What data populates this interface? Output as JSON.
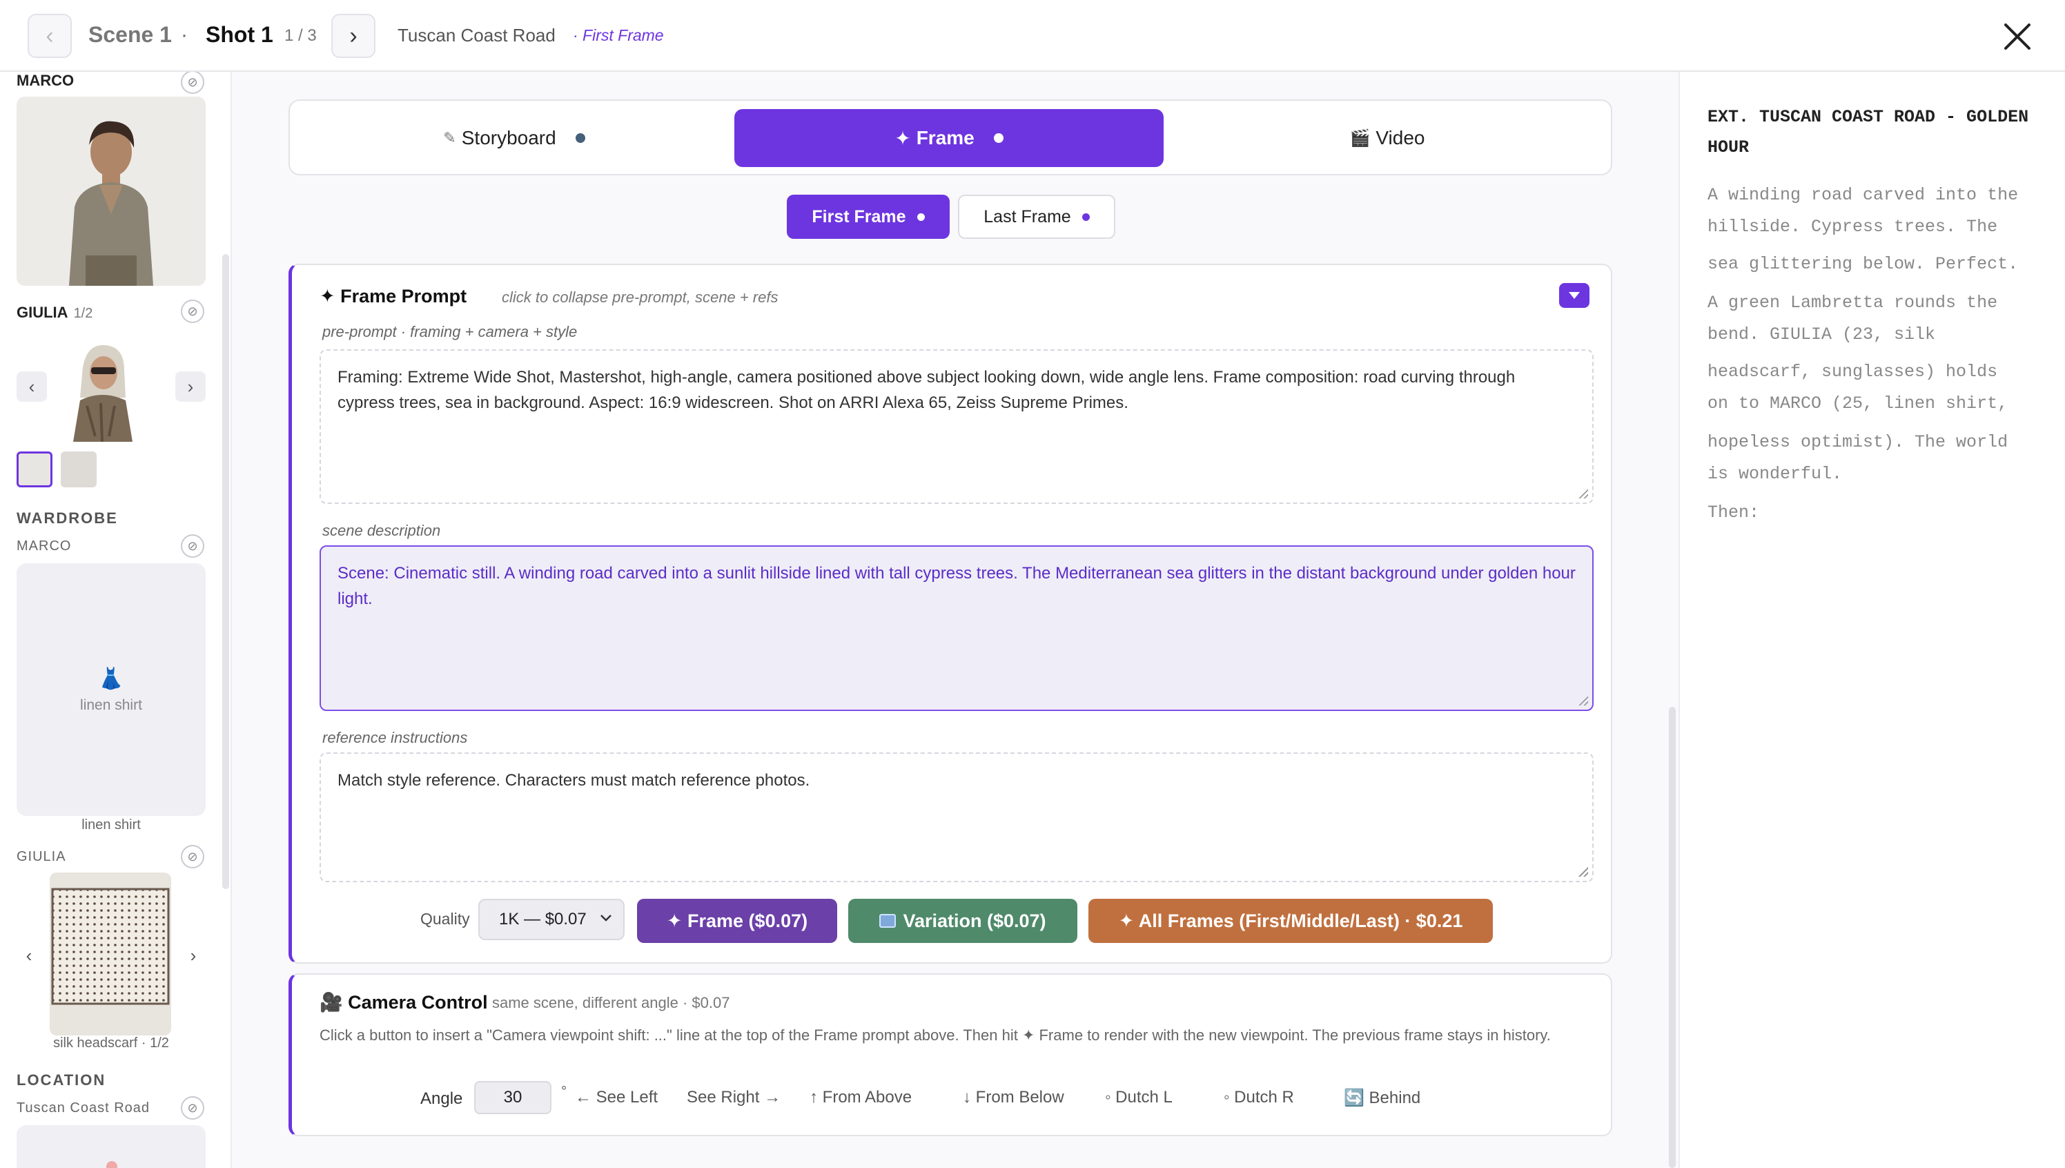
{
  "header": {
    "prev_icon": "chevron-left",
    "scene": "Scene 1",
    "separator": "·",
    "shot": "Shot 1",
    "shot_count": "1 / 3",
    "next_icon": "chevron-right",
    "location": "Tuscan Coast Road",
    "frame_tag": "· First Frame",
    "close_icon": "close-x"
  },
  "sidebar": {
    "characters": [
      {
        "name": "MARCO",
        "count": ""
      },
      {
        "name": "GIULIA",
        "count": "1/2"
      }
    ],
    "wardrobe_heading": "WARDROBE",
    "wardrobe": [
      {
        "character": "MARCO",
        "item": "linen shirt",
        "caption": "linen shirt"
      },
      {
        "character": "GIULIA",
        "caption": "silk headscarf · 1/2"
      }
    ],
    "location_heading": "LOCATION",
    "location_name": "Tuscan Coast Road",
    "arrow_prev": "‹",
    "arrow_next": "›",
    "lock_glyph": "⊘"
  },
  "tabs": [
    {
      "icon": "✎",
      "label": "Storyboard"
    },
    {
      "icon": "✦",
      "label": "Frame"
    },
    {
      "icon": "🎬",
      "label": "Video"
    }
  ],
  "subtabs": {
    "first": "First Frame",
    "last": "Last Frame"
  },
  "frame_prompt": {
    "title": "✦ Frame Prompt",
    "hint": "click to collapse pre-prompt, scene + refs",
    "preprompt_label": "pre-prompt · framing + camera + style",
    "preprompt": "Framing: Extreme Wide Shot, Mastershot, high-angle, camera positioned above subject looking down, wide angle lens. Frame composition: road curving through cypress trees, sea in background. Aspect: 16:9 widescreen. Shot on ARRI Alexa 65, Zeiss Supreme Primes.",
    "scene_label": "scene description",
    "scene": "Scene: Cinematic still. A winding road carved into a sunlit hillside lined with tall cypress trees. The Mediterranean sea glitters in the distant background under golden hour light.",
    "refs_label": "reference instructions",
    "refs": "Match style reference. Characters must match reference photos.",
    "quality_label": "Quality",
    "quality_value": "1K — $0.07",
    "btn_frame": "✦ Frame ($0.07)",
    "btn_variation": "Variation ($0.07)",
    "btn_all": "✦ All Frames (First/Middle/Last) · $0.21",
    "colors": {
      "accent": "#6d35e0",
      "frame_btn": "#6b40a8",
      "variation_btn": "#4f8a6a",
      "all_btn": "#c0703f"
    }
  },
  "camera": {
    "title": "🎥 Camera Control",
    "hint": "same scene, different angle · $0.07",
    "desc": "Click a button to insert a \"Camera viewpoint shift: ...\" line at the top of the Frame prompt above. Then hit ✦ Frame to render with the new viewpoint. The previous frame stays in history.",
    "angle_label": "Angle",
    "angle_value": "30",
    "deg": "°",
    "buttons": [
      "← See Left",
      "See Right →",
      "↑ From Above",
      "↓ From Below",
      "◦ Dutch L",
      "◦ Dutch R",
      "🔄 Behind"
    ]
  },
  "script": {
    "heading": "EXT. TUSCAN COAST ROAD - GOLDEN HOUR",
    "lines": [
      "A winding road carved into the",
      "hillside. Cypress trees. The",
      "sea glittering below. Perfect.",
      "A green Lambretta rounds the",
      "bend. GIULIA (23, silk",
      "headscarf, sunglasses) holds",
      "on to MARCO (25, linen shirt,",
      "hopeless optimist). The world",
      "is wonderful.",
      "Then:"
    ]
  }
}
